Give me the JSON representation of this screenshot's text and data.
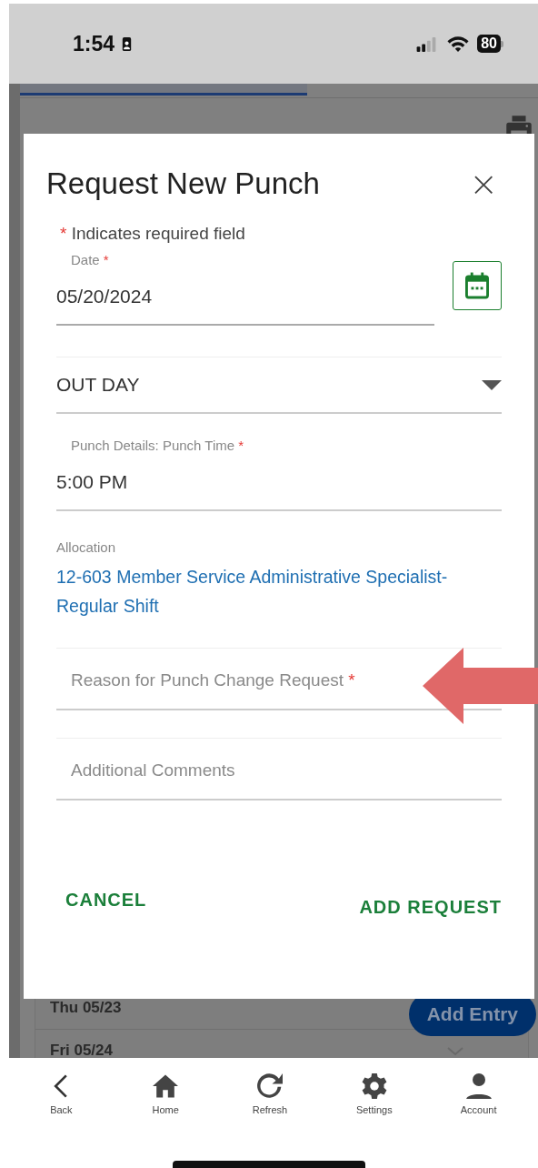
{
  "status_bar": {
    "time": "1:54",
    "battery": "80"
  },
  "background": {
    "tabs": [
      {
        "selected": true
      }
    ],
    "rows": [
      {
        "label": "Thu 05/23"
      },
      {
        "label": "Fri 05/24"
      }
    ],
    "fab": "Add Entry"
  },
  "dialog": {
    "title": "Request New Punch",
    "close": "×",
    "required_note": {
      "mark": "*",
      "text": "Indicates required field"
    },
    "fields": [
      {
        "kind": "date",
        "label": "Date",
        "mark": "*",
        "value": "05/20/2024"
      },
      {
        "kind": "select",
        "value": "OUT DAY"
      },
      {
        "kind": "text",
        "label": "Punch Details: Punch Time",
        "mark": "*",
        "value": "5:00 PM"
      },
      {
        "kind": "link",
        "label": "Allocation",
        "value": "12-603 Member Service Administrative Specialist- Regular Shift"
      },
      {
        "kind": "textarea",
        "placeholder": "Reason for Punch Change Request",
        "mark": "*"
      },
      {
        "kind": "textarea",
        "placeholder": "Additional Comments"
      }
    ],
    "buttons": [
      {
        "label": "CANCEL",
        "kind": "cancel"
      },
      {
        "label": "ADD REQUEST",
        "kind": "submit"
      }
    ]
  },
  "annotation": {
    "kind": "arrow"
  },
  "nav": [
    {
      "label": "Back"
    },
    {
      "label": "Home"
    },
    {
      "label": "Refresh"
    },
    {
      "label": "Settings"
    },
    {
      "label": "Account"
    }
  ]
}
